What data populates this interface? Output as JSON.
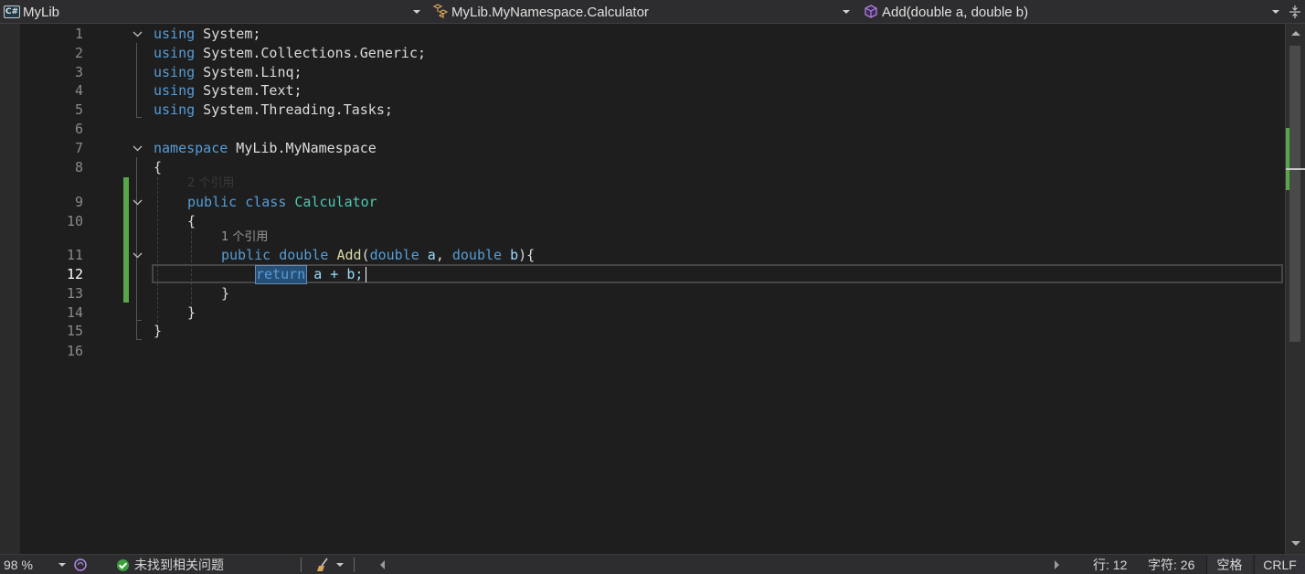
{
  "nav": {
    "project": "MyLib",
    "project_icon": "C#",
    "class": "MyLib.MyNamespace.Calculator",
    "member": "Add(double a, double b)"
  },
  "editor": {
    "lines": [
      {
        "n": "1"
      },
      {
        "n": "2"
      },
      {
        "n": "3"
      },
      {
        "n": "4"
      },
      {
        "n": "5"
      },
      {
        "n": "6"
      },
      {
        "n": "7"
      },
      {
        "n": "8"
      },
      {
        "n": "9"
      },
      {
        "n": "10"
      },
      {
        "n": "11"
      },
      {
        "n": "12"
      },
      {
        "n": "13"
      },
      {
        "n": "14"
      },
      {
        "n": "15"
      },
      {
        "n": "16"
      }
    ],
    "code": {
      "l1_kw": "using",
      "l1_rest": " System;",
      "l2_kw": "using",
      "l2_rest": " System.Collections.Generic;",
      "l3_kw": "using",
      "l3_rest": " System.Linq;",
      "l4_kw": "using",
      "l4_rest": " System.Text;",
      "l5_kw": "using",
      "l5_rest": " System.Threading.Tasks;",
      "l7_kw": "namespace",
      "l7_rest": " MyLib.MyNamespace",
      "l8": "{",
      "l9_kw1": "public",
      "l9_kw2": "class",
      "l9_type": "Calculator",
      "l10": "{",
      "l11_kw1": "public",
      "l11_kw2": "double",
      "l11_fn": "Add",
      "l11_p1": "(",
      "l11_kw3": "double",
      "l11_a": " a",
      "l11_comma": ", ",
      "l11_kw4": "double",
      "l11_b": " b",
      "l11_end": "){",
      "l12_kw": "return",
      "l12_rest": " a + b;",
      "l13": "}",
      "l14": "}",
      "l15": "}"
    },
    "codelens_class": "2 个引用",
    "codelens_method": "1 个引用"
  },
  "status": {
    "zoom": "98 %",
    "issues": "未找到相关问题",
    "line": "行: 12",
    "col": "字符: 26",
    "indent": "空格",
    "eol": "CRLF"
  },
  "colors": {
    "keyword": "#569cd6",
    "type": "#4ec9b0",
    "method": "#dcdcaa",
    "change_bar": "#57a64a",
    "background": "#1e1e1e"
  }
}
